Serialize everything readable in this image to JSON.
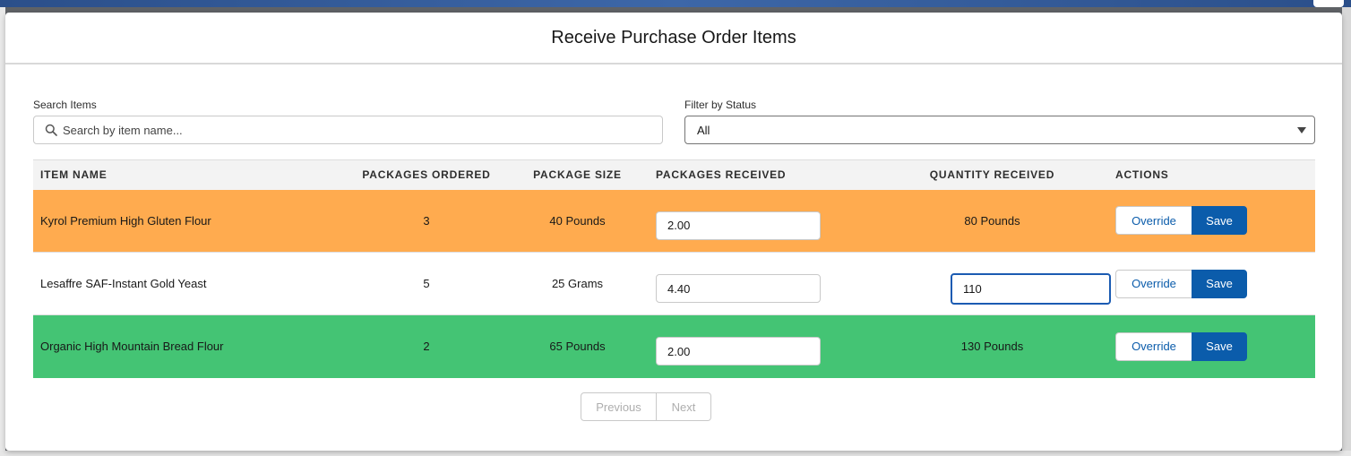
{
  "modal": {
    "title": "Receive Purchase Order Items"
  },
  "filters": {
    "search_label": "Search Items",
    "search_placeholder": "Search by item name...",
    "status_label": "Filter by Status",
    "status_value": "All"
  },
  "table": {
    "columns": [
      "ITEM NAME",
      "PACKAGES ORDERED",
      "PACKAGE SIZE",
      "PACKAGES RECEIVED",
      "QUANTITY RECEIVED",
      "ACTIONS"
    ],
    "rows": [
      {
        "item_name": "Kyrol Premium High Gluten Flour",
        "packages_ordered": "3",
        "package_size": "40 Pounds",
        "packages_received": "2.00",
        "quantity_received": "80 Pounds",
        "row_color": "#ffab4f"
      },
      {
        "item_name": "Lesaffre SAF-Instant Gold Yeast",
        "packages_ordered": "5",
        "package_size": "25 Grams",
        "packages_received": "4.40",
        "quantity_received": "110",
        "row_color": "#ffffff"
      },
      {
        "item_name": "Organic High Mountain Bread Flour",
        "packages_ordered": "2",
        "package_size": "65 Pounds",
        "packages_received": "2.00",
        "quantity_received": "130 Pounds",
        "row_color": "#44c474"
      }
    ],
    "override_label": "Override",
    "save_label": "Save"
  },
  "pagination": {
    "previous_label": "Previous",
    "next_label": "Next"
  },
  "colors": {
    "accent": "#0b5cab",
    "focus_border": "#1b5bb2"
  }
}
